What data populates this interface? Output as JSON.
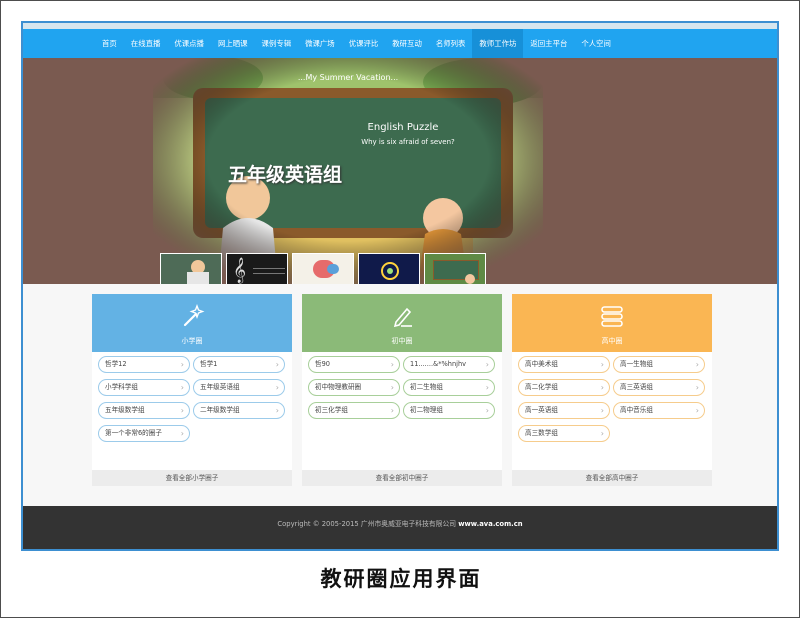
{
  "nav": {
    "items": [
      "首页",
      "在线直播",
      "优课点播",
      "网上晒课",
      "课例专辑",
      "微课广场",
      "优课评比",
      "教研互动",
      "名师列表",
      "教师工作坊",
      "返回主平台",
      "个人空间"
    ],
    "active_index": 9
  },
  "banner": {
    "title": "五年级英语组",
    "board_heading": "English Puzzle",
    "board_subtitle": "Why is six afraid of seven?",
    "vacation_text": "...My Summer Vacation..."
  },
  "panels": [
    {
      "name": "小学圈",
      "accent": "#63b2e4",
      "border": "#9ccbea",
      "icon": "wand-icon",
      "groups": [
        "哲学12",
        "哲学1",
        "小学科学组",
        "五年级英语组",
        "五年级数学组",
        "二年级数学组",
        "第一个非常6的圈子"
      ],
      "footer": "查看全部小学圈子"
    },
    {
      "name": "初中圈",
      "accent": "#8bba78",
      "border": "#a8cf9a",
      "icon": "pencil-icon",
      "groups": [
        "哲90",
        "11.......&*%hnjhv",
        "初中物理教研圈",
        "初二生物组",
        "初三化学组",
        "初二物理组"
      ],
      "footer": "查看全部初中圈子"
    },
    {
      "name": "高中圈",
      "accent": "#fab653",
      "border": "#f6cc8c",
      "icon": "stack-icon",
      "groups": [
        "高中美术组",
        "高一生物组",
        "高二化学组",
        "高三英语组",
        "高一英语组",
        "高中音乐组",
        "高三数学组"
      ],
      "footer": "查看全部高中圈子"
    }
  ],
  "footer": {
    "copyright": "Copyright © 2005-2015 广州市奥威亚电子科技有限公司",
    "domain": "www.ava.com.cn"
  },
  "caption": "教研圈应用界面"
}
